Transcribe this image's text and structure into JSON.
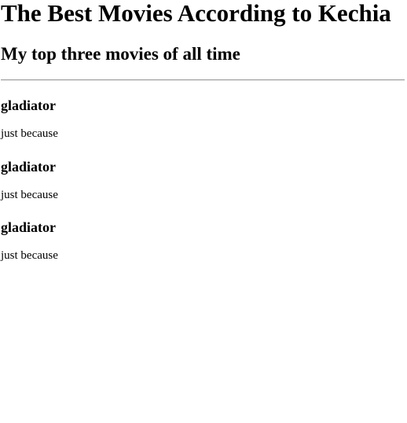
{
  "page": {
    "title": "The Best Movies According to Kechia",
    "subtitle": "My top three movies of all time"
  },
  "movies": [
    {
      "title": "gladiator",
      "reason": "just because"
    },
    {
      "title": "gladiator",
      "reason": "just because"
    },
    {
      "title": "gladiator",
      "reason": "just because"
    }
  ]
}
